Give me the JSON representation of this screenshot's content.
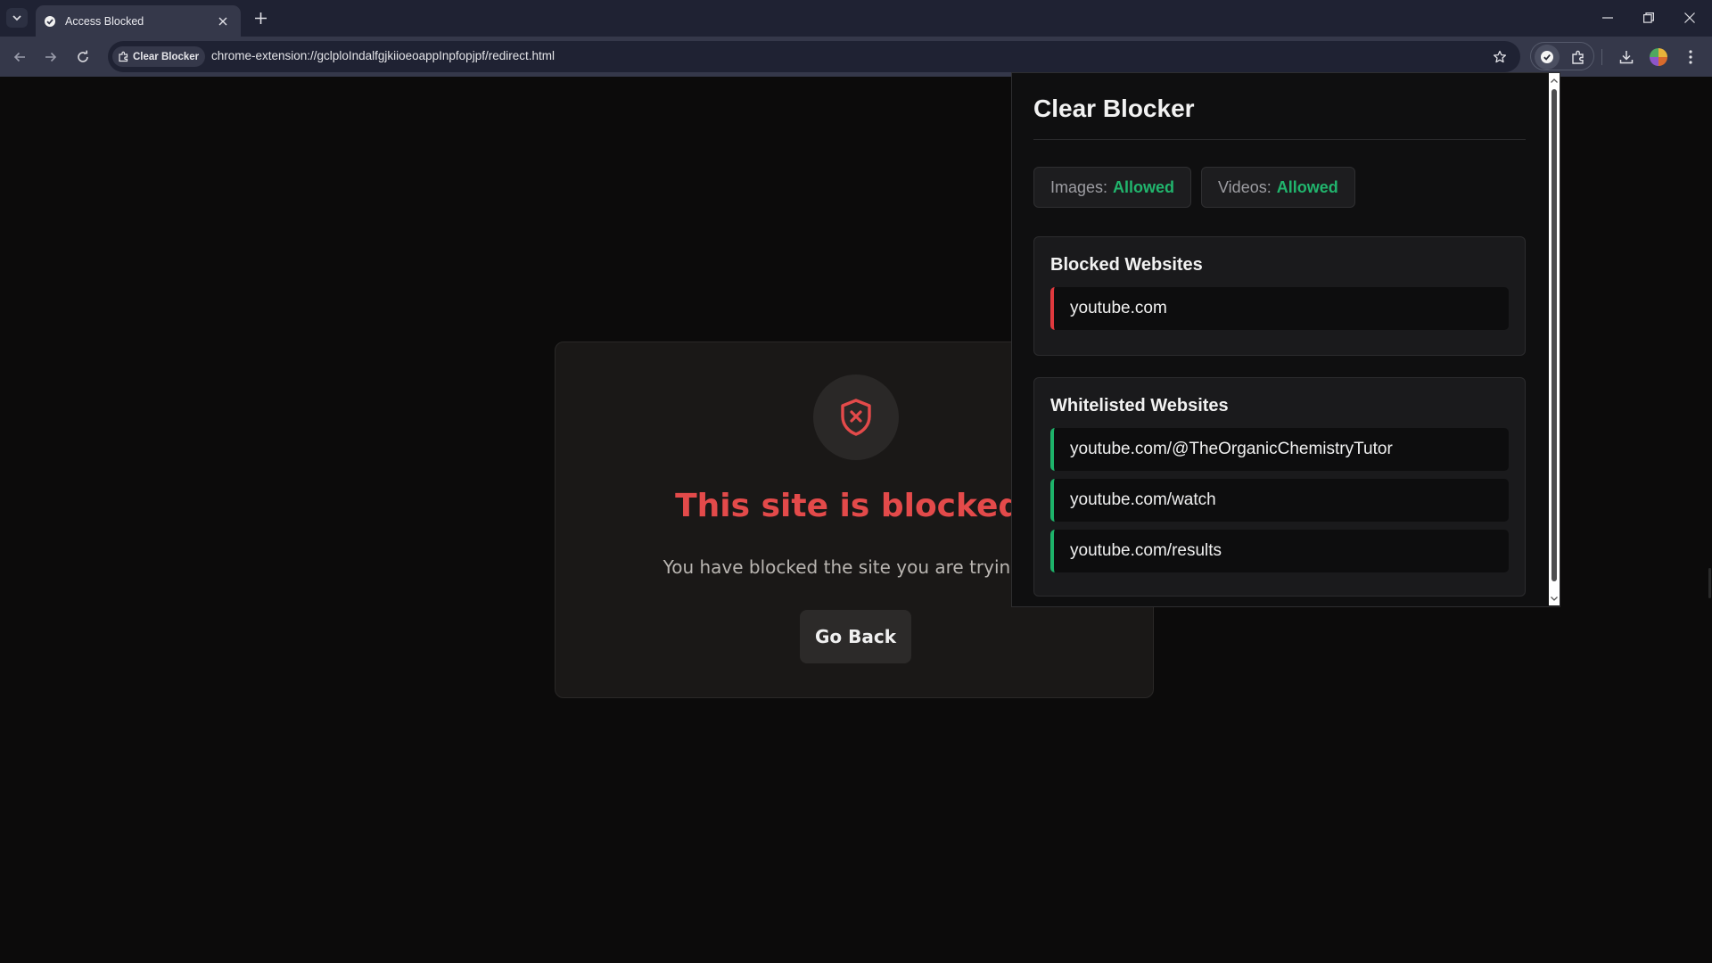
{
  "browser": {
    "tab_title": "Access Blocked",
    "site_chip": "Clear Blocker",
    "url": "chrome-extension://gclploIndalfgjkiioeoappInpfopjpf/redirect.html",
    "icons": [
      "tab-search-icon",
      "extension-favicon",
      "close-icon",
      "plus-icon",
      "minimize-icon",
      "restore-icon",
      "close-window-icon",
      "back-icon",
      "forward-icon",
      "reload-icon",
      "extension-chip-icon",
      "star-icon",
      "clear-blocker-extension-icon",
      "puzzle-icon",
      "download-icon",
      "profile-avatar",
      "more-menu-icon"
    ]
  },
  "page": {
    "title": "This site is blocked.",
    "message": "You have blocked the site you are trying to",
    "go_back": "Go Back",
    "icon": "shield-x-icon"
  },
  "popup": {
    "title": "Clear Blocker",
    "images_label": "Images:",
    "images_value": "Allowed",
    "videos_label": "Videos:",
    "videos_value": "Allowed",
    "blocked_title": "Blocked Websites",
    "blocked": [
      "youtube.com"
    ],
    "whitelist_title": "Whitelisted Websites",
    "whitelist": [
      "youtube.com/@TheOrganicChemistryTutor",
      "youtube.com/watch",
      "youtube.com/results"
    ]
  },
  "colors": {
    "accent_red": "#e34a4a",
    "allowed_green": "#21b56d",
    "chrome_dark": "#1f2233",
    "chrome_toolbar": "#35384a"
  }
}
